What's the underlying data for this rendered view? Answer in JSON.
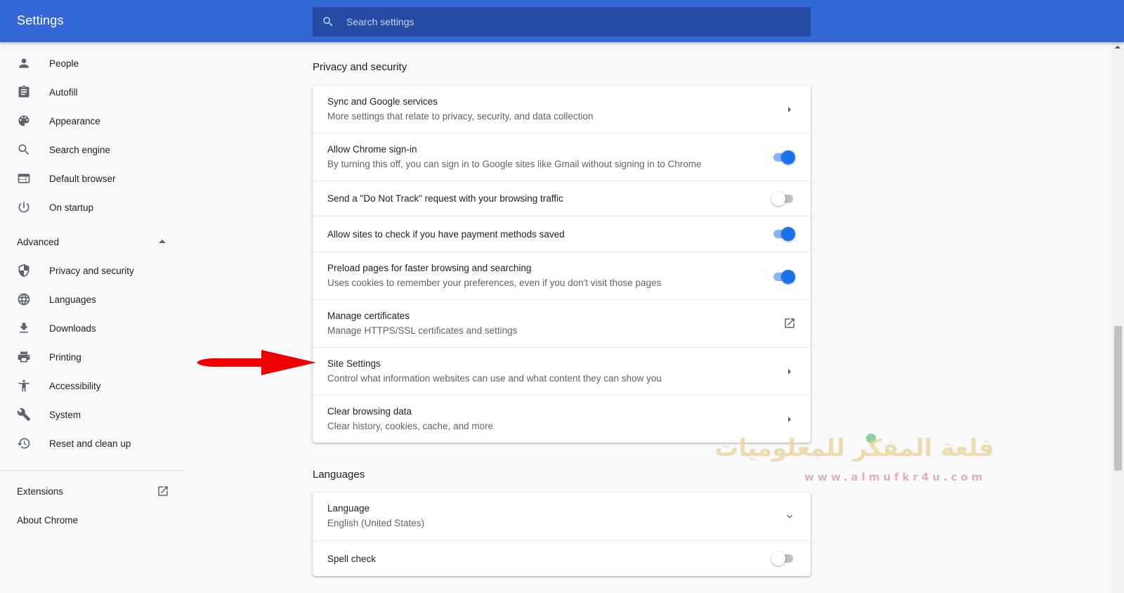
{
  "app": {
    "title": "Settings",
    "accent_color": "#3367d6"
  },
  "search": {
    "placeholder": "Search settings",
    "icon": "search-icon"
  },
  "sidebar": {
    "items": [
      {
        "label": "People",
        "icon": "person-icon"
      },
      {
        "label": "Autofill",
        "icon": "clipboard-icon"
      },
      {
        "label": "Appearance",
        "icon": "palette-icon"
      },
      {
        "label": "Search engine",
        "icon": "search-icon"
      },
      {
        "label": "Default browser",
        "icon": "browser-window-icon"
      },
      {
        "label": "On startup",
        "icon": "power-icon"
      }
    ],
    "advanced_label": "Advanced",
    "advanced_items": [
      {
        "label": "Privacy and security",
        "icon": "shield-icon"
      },
      {
        "label": "Languages",
        "icon": "globe-icon"
      },
      {
        "label": "Downloads",
        "icon": "download-icon"
      },
      {
        "label": "Printing",
        "icon": "printer-icon"
      },
      {
        "label": "Accessibility",
        "icon": "accessibility-icon"
      },
      {
        "label": "System",
        "icon": "wrench-icon"
      },
      {
        "label": "Reset and clean up",
        "icon": "history-icon"
      }
    ],
    "extensions_label": "Extensions",
    "about_label": "About Chrome"
  },
  "privacy": {
    "heading": "Privacy and security",
    "rows": [
      {
        "title": "Sync and Google services",
        "subtitle": "More settings that relate to privacy, security, and data collection",
        "control": "arrow"
      },
      {
        "title": "Allow Chrome sign-in",
        "subtitle": "By turning this off, you can sign in to Google sites like Gmail without signing in to Chrome",
        "control": "toggle",
        "on": true
      },
      {
        "title": "Send a \"Do Not Track\" request with your browsing traffic",
        "control": "toggle",
        "on": false
      },
      {
        "title": "Allow sites to check if you have payment methods saved",
        "control": "toggle",
        "on": true
      },
      {
        "title": "Preload pages for faster browsing and searching",
        "subtitle": "Uses cookies to remember your preferences, even if you don't visit those pages",
        "control": "toggle",
        "on": true
      },
      {
        "title": "Manage certificates",
        "subtitle": "Manage HTTPS/SSL certificates and settings",
        "control": "launch"
      },
      {
        "title": "Site Settings",
        "subtitle": "Control what information websites can use and what content they can show you",
        "control": "arrow"
      },
      {
        "title": "Clear browsing data",
        "subtitle": "Clear history, cookies, cache, and more",
        "control": "arrow"
      }
    ]
  },
  "languages": {
    "heading": "Languages",
    "language_row": {
      "title": "Language",
      "subtitle": "English (United States)"
    },
    "spellcheck_row": {
      "title": "Spell check",
      "on": false
    }
  },
  "watermark": {
    "arabic_text": "قلعة المفكر للمعلوميات",
    "url_text": "www.almufkr4u.com"
  },
  "colors": {
    "toggle_on": "#1a73e8",
    "annotation_arrow": "#ee0000"
  }
}
